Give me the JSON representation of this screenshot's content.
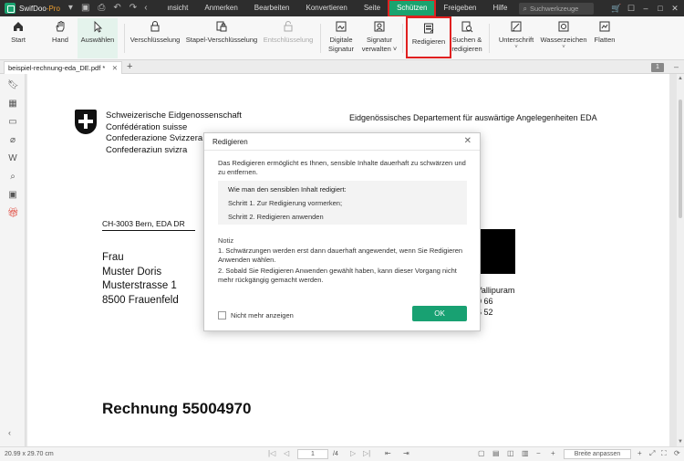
{
  "app": {
    "name": "SwifDoo",
    "edition": "-Pro"
  },
  "menu": {
    "items": [
      {
        "label": "ınsicht",
        "active": false
      },
      {
        "label": "Anmerken",
        "active": false
      },
      {
        "label": "Bearbeiten",
        "active": false
      },
      {
        "label": "Konvertieren",
        "active": false
      },
      {
        "label": "Seite",
        "active": false
      },
      {
        "label": "Schützen",
        "active": true
      },
      {
        "label": "Freigeben",
        "active": false
      },
      {
        "label": "Hilfe",
        "active": false
      }
    ],
    "search_placeholder": "Suchwerkzeuge"
  },
  "ribbon": {
    "start": "Start",
    "hand": "Hand",
    "select": "Auswählen",
    "encrypt": "Verschlüsselung",
    "batch_encrypt": "Stapel-Verschlüsselung",
    "decrypt": "Entschlüsselung",
    "digital_signature_1": "Digitale",
    "digital_signature_2": "Signatur",
    "manage_signature_1": "Signatur",
    "manage_signature_2": "verwalten",
    "redact": "Redigieren",
    "search_redact_1": "Suchen &",
    "search_redact_2": "redigieren",
    "signature": "Unterschrift",
    "watermark": "Wasserzeichen",
    "flatten": "Flatten"
  },
  "tabs": {
    "document": "beispiel-rechnung-eda_DE.pdf *",
    "page_badge": "1"
  },
  "document": {
    "swiss_lines": [
      "Schweizerische Eidgenossenschaft",
      "Confédération suisse",
      "Confederazione Svizzera",
      "Confederaziun svizra"
    ],
    "department": "Eidgenössisches Departement für auswärtige Angelegenheiten EDA",
    "sender": "CH-3003 Bern, EDA DR",
    "address": [
      "Frau",
      "Muster Doris",
      "Musterstrasse 1",
      "8500 Frauenfeld"
    ],
    "contact": [
      "ar Vallipuram",
      "00 66",
      "36 52"
    ],
    "invoice_title": "Rechnung 55004970"
  },
  "dialog": {
    "title": "Redigieren",
    "intro": "Das Redigieren ermöglicht es Ihnen, sensible Inhalte dauerhaft zu schwärzen und zu entfernen.",
    "box_heading": "Wie man den sensiblen Inhalt redigiert:",
    "step1": "Schritt 1. Zur Redigierung vormerken;",
    "step2": "Schritt 2. Redigieren anwenden",
    "note_heading": "Notiz",
    "note1": "1. Schwärzungen werden erst dann dauerhaft angewendet, wenn Sie Redigieren Anwenden wählen.",
    "note2": "2. Sobald Sie Redigieren Anwenden gewählt haben, kann dieser Vorgang nicht mehr rückgängig gemacht werden.",
    "checkbox_label": "Nicht mehr anzeigen",
    "ok_label": "OK"
  },
  "status": {
    "dimensions": "20.99 x 29.70 cm",
    "current_page": "1",
    "total_pages": "/4",
    "zoom_mode": "Breite anpassen"
  },
  "colors": {
    "accent": "#1aa36f",
    "highlight": "#e02020",
    "titlebar": "#2d2d2d"
  }
}
